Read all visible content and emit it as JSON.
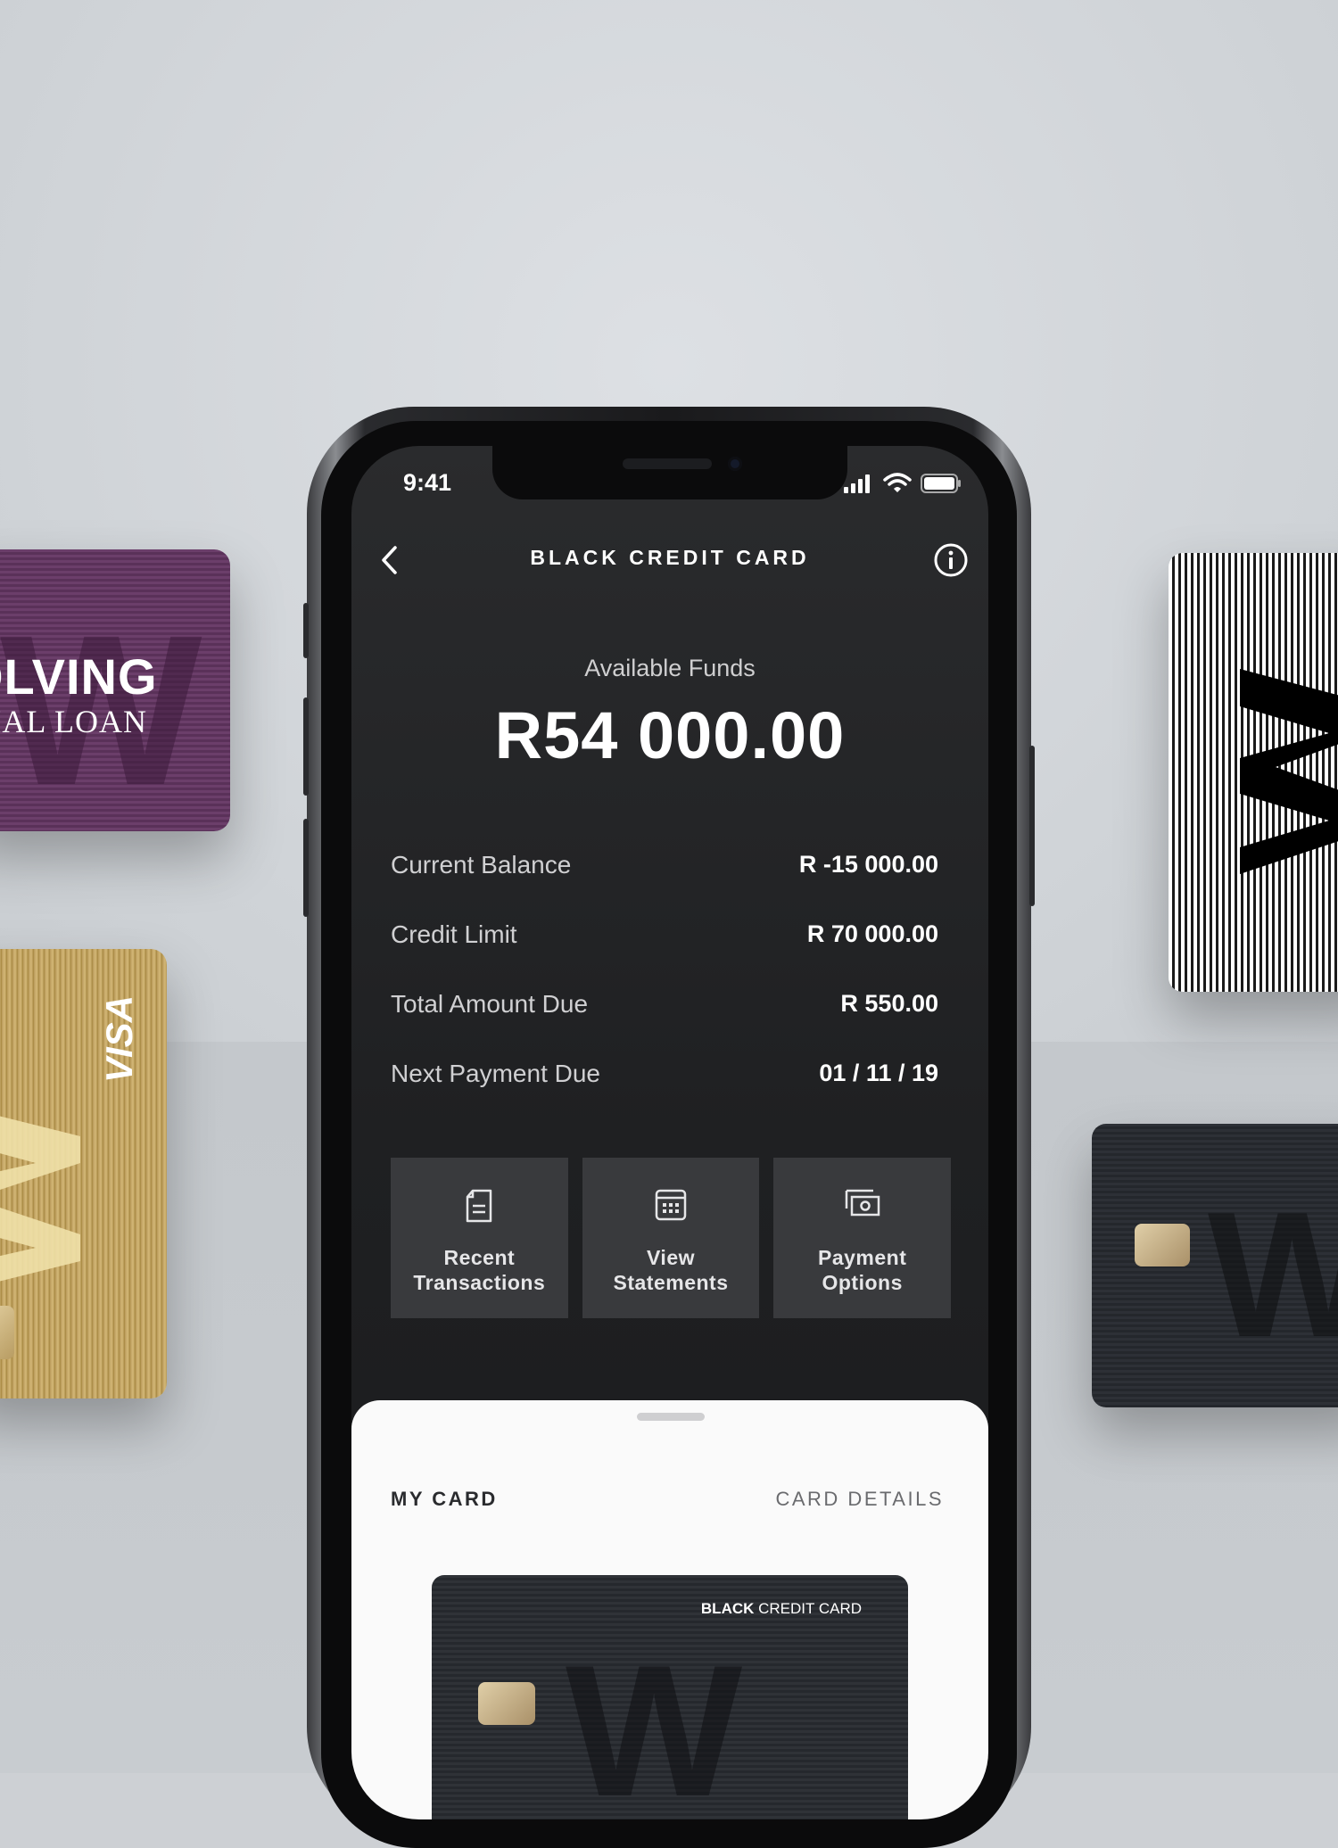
{
  "status_bar": {
    "time": "9:41"
  },
  "header": {
    "title": "BLACK CREDIT CARD"
  },
  "funds": {
    "label": "Available Funds",
    "value": "R54 000.00"
  },
  "details": [
    {
      "label": "Current Balance",
      "value": "R -15 000.00"
    },
    {
      "label": "Credit Limit",
      "value": "R 70 000.00"
    },
    {
      "label": "Total Amount Due",
      "value": "R 550.00"
    },
    {
      "label": "Next Payment Due",
      "value": "01 / 11 / 19"
    }
  ],
  "actions": [
    {
      "line1": "Recent",
      "line2": "Transactions",
      "icon": "receipt-icon"
    },
    {
      "line1": "View",
      "line2": "Statements",
      "icon": "calendar-icon"
    },
    {
      "line1": "Payment",
      "line2": "Options",
      "icon": "cash-icon"
    }
  ],
  "sheet": {
    "my_card": "MY CARD",
    "card_details": "CARD DETAILS",
    "card_brand_bold": "BLACK",
    "card_brand_rest": " CREDIT CARD"
  },
  "background_cards": {
    "purple_line1": "OLVING",
    "purple_line2": "IAL LOAN",
    "gold_brand": "VISA"
  },
  "colors": {
    "screen_bg": "#1f2022",
    "action_tile": "#393a3d",
    "sheet_bg": "#fafafa",
    "purple_card": "#6b3e6a",
    "gold_card": "#c4a566"
  }
}
